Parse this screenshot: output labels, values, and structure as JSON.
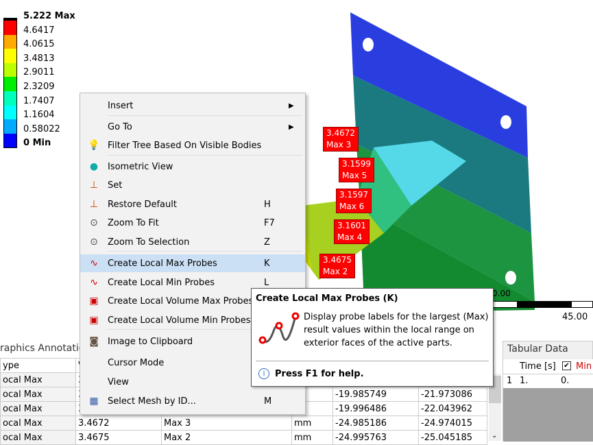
{
  "legend": {
    "colors": [
      "#ff0000",
      "#ffaa00",
      "#ffff00",
      "#bbff00",
      "#00ee00",
      "#00ffbb",
      "#00ffff",
      "#00aaff",
      "#0000ff"
    ],
    "labels": [
      "5.222 Max",
      "4.6417",
      "4.0615",
      "3.4813",
      "2.9011",
      "2.3209",
      "1.7407",
      "1.1604",
      "0.58022",
      "0 Min"
    ]
  },
  "probes": [
    {
      "value": "3.4672",
      "name": "Max 3"
    },
    {
      "value": "3.1599",
      "name": "Max 5"
    },
    {
      "value": "3.1597",
      "name": "Max 6"
    },
    {
      "value": "3.1601",
      "name": "Max 4"
    },
    {
      "value": "3.4675",
      "name": "Max 2"
    }
  ],
  "scale": {
    "left": "0.00",
    "right": "45.00"
  },
  "menu": {
    "items": [
      {
        "label": "Insert",
        "shortcut": "",
        "submenu": true,
        "icon": ""
      },
      {
        "label": "Go To",
        "shortcut": "",
        "submenu": true,
        "icon": ""
      },
      {
        "label": "Filter Tree Based On Visible Bodies",
        "shortcut": "",
        "icon": "bulb-icon"
      },
      {
        "label": "Isometric View",
        "shortcut": "",
        "icon": "sphere-icon"
      },
      {
        "label": "Set",
        "shortcut": "",
        "icon": "axes-icon"
      },
      {
        "label": "Restore Default",
        "shortcut": "H",
        "icon": "axes-icon"
      },
      {
        "label": "Zoom To Fit",
        "shortcut": "F7",
        "icon": "zoom-icon"
      },
      {
        "label": "Zoom To Selection",
        "shortcut": "Z",
        "icon": "zoom-icon"
      },
      {
        "label": "Create Local Max Probes",
        "shortcut": "K",
        "icon": "max-probe-icon"
      },
      {
        "label": "Create Local Min Probes",
        "shortcut": "L",
        "icon": "min-probe-icon"
      },
      {
        "label": "Create Local Volume Max Probes",
        "shortcut": "",
        "icon": "volume-max-icon"
      },
      {
        "label": "Create Local Volume Min Probes",
        "shortcut": "",
        "icon": "volume-min-icon"
      },
      {
        "label": "Image to Clipboard",
        "shortcut": "",
        "icon": "camera-icon"
      },
      {
        "label": "Cursor Mode",
        "shortcut": "",
        "icon": ""
      },
      {
        "label": "View",
        "shortcut": "",
        "icon": ""
      },
      {
        "label": "Select Mesh by ID...",
        "shortcut": "M",
        "icon": "mesh-icon"
      }
    ]
  },
  "tooltip": {
    "title": "Create Local Max Probes (K)",
    "body": "Display probe labels for the largest (Max) result values within the local range on exterior faces of the active parts.",
    "help": "Press F1 for help."
  },
  "annotations": {
    "title": "raphics Annotatio",
    "header": [
      "ype",
      "V"
    ],
    "rows": [
      [
        "ocal Max",
        "3.",
        "",
        "",
        "",
        ""
      ],
      [
        "ocal Max",
        "3.",
        "",
        "n",
        "-19.985749",
        "-21.973086"
      ],
      [
        "ocal Max",
        "3.1601",
        "Max 4",
        "n",
        "-19.996486",
        "-22.043962"
      ],
      [
        "ocal Max",
        "3.4672",
        "Max 3",
        "mm",
        "-24.985186",
        "-24.974015"
      ],
      [
        "ocal Max",
        "3.4675",
        "Max 2",
        "mm",
        "-24.995763",
        "-25.045185"
      ]
    ]
  },
  "tabular": {
    "title": "Tabular Data",
    "headers": [
      "Time [s]",
      "Min"
    ],
    "rows": [
      [
        "1",
        "1.",
        "0."
      ]
    ]
  }
}
